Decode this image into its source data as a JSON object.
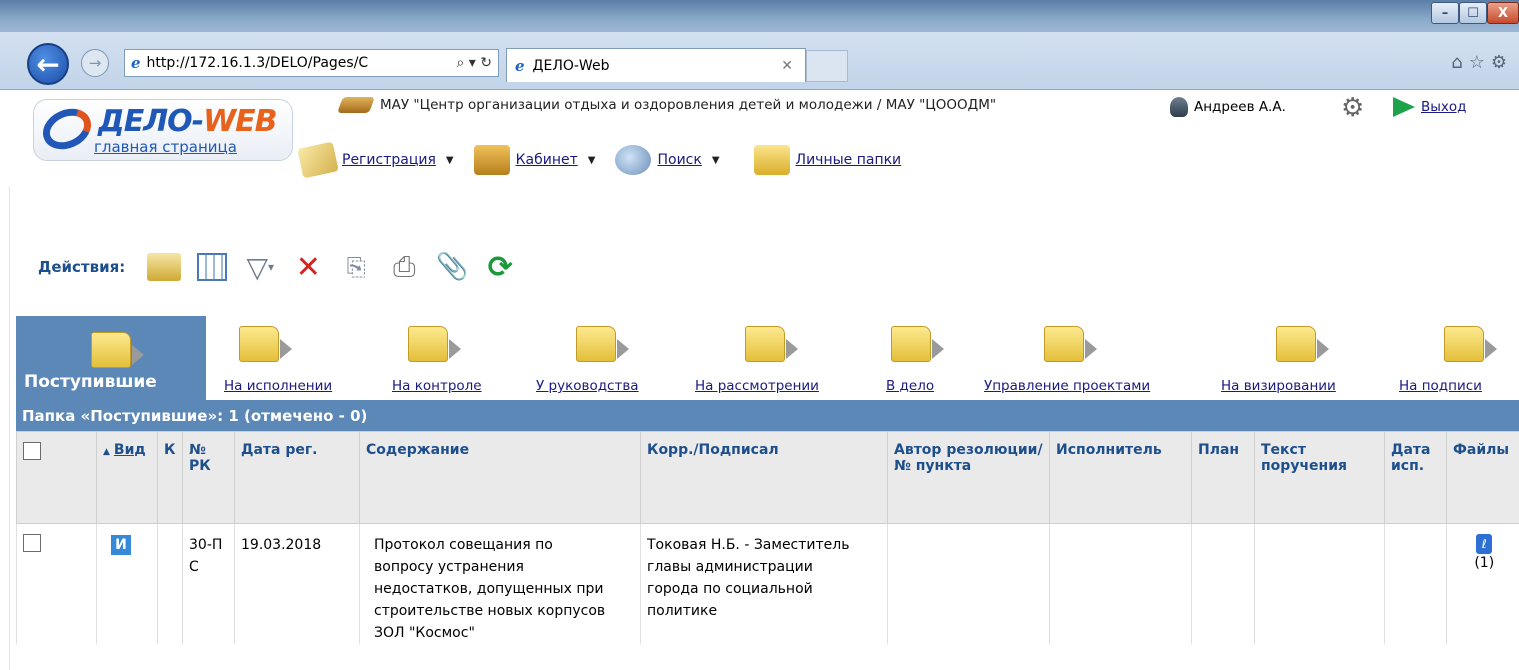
{
  "browser": {
    "url": "http://172.16.1.3/DELO/Pages/C",
    "address_tools": "⌕ ▾ ↻",
    "tab_title": "ДЕЛО-Web",
    "tab_close": "✕",
    "window_min": "–",
    "window_max": "☐",
    "window_close": "X",
    "right_icons": "⌂☆⚙"
  },
  "app": {
    "logo_title_a": "ДЕЛО-",
    "logo_title_b": "WEB",
    "logo_subtitle": "главная страница",
    "organization": "МАУ \"Центр организации отдыха и оздоровления детей и молодежи / МАУ \"ЦОООДМ\"",
    "user": "Андреев А.А.",
    "exit": "Выход"
  },
  "menu": [
    {
      "label": "Регистрация",
      "dropdown": true,
      "icon": "registration-icon"
    },
    {
      "label": "Кабинет",
      "dropdown": true,
      "icon": "cabinet-icon"
    },
    {
      "label": "Поиск",
      "dropdown": true,
      "icon": "search-icon"
    },
    {
      "label": "Личные папки",
      "dropdown": false,
      "icon": "personal-folders-icon"
    }
  ],
  "actions": {
    "label": "Действия:",
    "filter_caret": "▾",
    "delete_glyph": "✕",
    "copy_glyph": "⎘",
    "print_glyph": "⎙",
    "clip_glyph": "📎",
    "refresh_glyph": "⟳"
  },
  "folders": [
    "Поступившие",
    "На исполнении",
    "На контроле",
    "У руководства",
    "На рассмотрении",
    "В дело",
    "Управление проектами",
    "На визировании",
    "На подписи"
  ],
  "folder_status": "Папка «Поступившие»: 1 (отмечено - 0)",
  "table": {
    "sort_arrow": "▲",
    "headers": {
      "kind": "Вид",
      "k": "К",
      "num": "№ РК",
      "date": "Дата рег.",
      "content": "Содержание",
      "corr": "Корр./Подписал",
      "author": "Автор резолюции/ № пункта",
      "executor": "Исполнитель",
      "plan": "План",
      "task": "Текст поручения",
      "due": "Дата исп.",
      "files": "Файлы"
    },
    "rows": [
      {
        "kind": "И",
        "k": "",
        "num": "30-ПС",
        "date": "19.03.2018",
        "content": "Протокол совещания по вопросу устранения недостатков, допущенных при строительстве новых корпусов ЗОЛ \"Космос\"",
        "corr": "Токовая Н.Б. - Заместитель главы администрации города по социальной политике",
        "author": "",
        "executor": "",
        "plan": "",
        "task": "",
        "due": "",
        "files_count": "(1)"
      }
    ]
  }
}
